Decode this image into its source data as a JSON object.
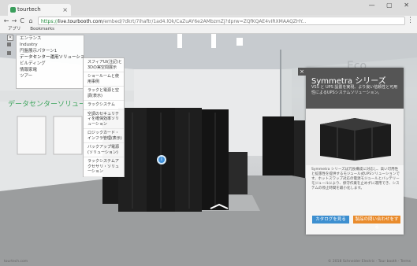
{
  "browser": {
    "tab_title": "tourtech",
    "tab_close": "×",
    "window_controls": "— ▢ ✕",
    "nav": {
      "back": "←",
      "forward": "→",
      "reload": "C",
      "home": "⌂"
    },
    "url": {
      "scheme": "https://",
      "host": "live.tourbooth.com",
      "path": "/embed/?dkrt/7ihaftr/1ad4.lOk/CaZuAY6e2AMbzmZj?dprw=ZQfKQAE4vIRXMAAQZHY..."
    },
    "menu": "⋮",
    "bookmarks": {
      "apps": "アプリ",
      "bookmarks": "Bookmarks"
    }
  },
  "viewer": {
    "sidebar_toggle": "✕",
    "menu_main": [
      "エンランス",
      "Industry",
      "円盤展示パターン1",
      "データセンター運用ソリューション",
      "ビルディング",
      "情報家電",
      "ツアー"
    ],
    "menu_sub": [
      "スフィアUI(注記)と3Dの実空間展示",
      "ショールームと使用事例",
      "ラックと電源と空調(表示)",
      "ラックシステム",
      "空調のセキュリティを確保効率ソリューション",
      "ロジックカード・インフラ管理(表示)",
      "バックアップ電源(ソリューション)",
      "ラックシステムアクセサリ・ソリューション"
    ],
    "hotspot_icon": "i",
    "wall_sign": "データセンターソリューション"
  },
  "infopanel": {
    "close": "×",
    "title": "Symmetra シリーズ",
    "subtitle": "VSS と UPS 設置を実現、より良い信頼性と可用性によるUPSシステムソリューション。",
    "description": "Symmetra シリーズは冗長構成に対応し、高い可用性と拡張性を提供するモジュール式UPSソリューションです。ホットスワップ対応の電源モジュールとバッテリーモジュールにより、保守作業を止めずに運用でき、システムの停止時間を最小化します。",
    "btn_primary": "カタログを見る",
    "btn_secondary": "製品の問い合わせをする"
  },
  "footer": {
    "status": "tourtech.com",
    "copyright": "© 2018 Schneider Electric · Tour booth · Terms"
  },
  "colors": {
    "accent_blue": "#3d8fd0",
    "accent_orange": "#e98b2c",
    "panel_header": "#464646"
  }
}
